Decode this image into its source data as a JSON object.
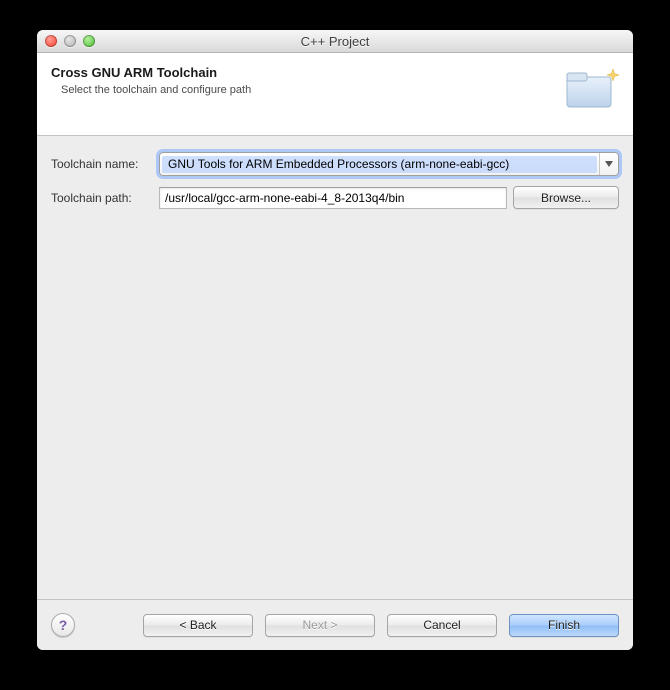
{
  "window": {
    "title": "C++ Project"
  },
  "banner": {
    "heading": "Cross GNU ARM Toolchain",
    "subtext": "Select the toolchain and configure path"
  },
  "form": {
    "toolchain_name_label": "Toolchain name:",
    "toolchain_name_value": "GNU Tools for ARM Embedded Processors (arm-none-eabi-gcc)",
    "toolchain_path_label": "Toolchain path:",
    "toolchain_path_value": "/usr/local/gcc-arm-none-eabi-4_8-2013q4/bin",
    "browse_label": "Browse..."
  },
  "footer": {
    "help_glyph": "?",
    "back_label": "< Back",
    "next_label": "Next >",
    "cancel_label": "Cancel",
    "finish_label": "Finish"
  }
}
